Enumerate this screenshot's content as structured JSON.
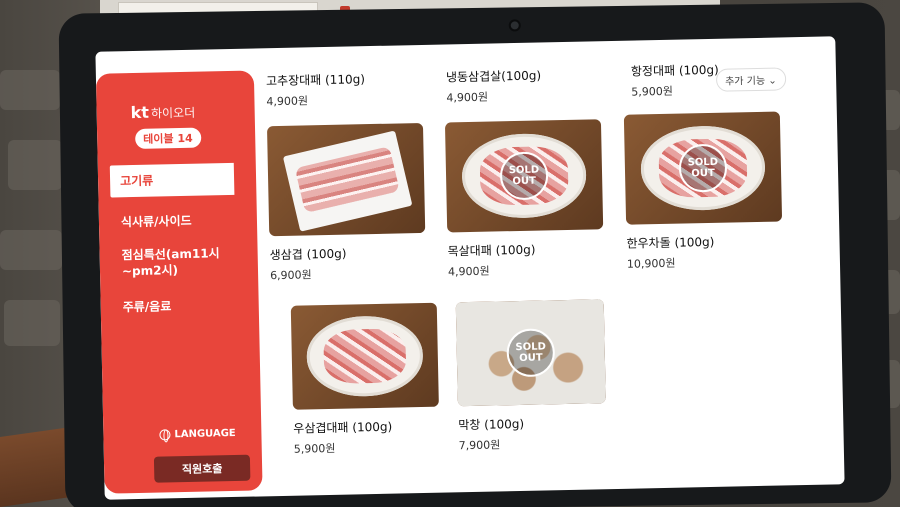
{
  "sidebar": {
    "brand_prefix": "kt",
    "brand_name": "하이오더",
    "table_label": "테이블 14",
    "categories": [
      {
        "label": "고기류"
      },
      {
        "label": "식사류/사이드"
      },
      {
        "label": "점심특선(am11시~pm2시)"
      },
      {
        "label": "주류/음료"
      }
    ],
    "language_label": "LANGUAGE",
    "call_staff_label": "직원호출"
  },
  "toolbar": {
    "more_label": "추가 기능"
  },
  "menu": {
    "top_row": [
      {
        "name": "고추장대패 (110g)",
        "price": "4,900원"
      },
      {
        "name": "냉동삼겹살(100g)",
        "price": "4,900원"
      },
      {
        "name": "항정대패 (100g)",
        "price": "5,900원"
      }
    ],
    "items": [
      {
        "name": "생삼겹 (100g)",
        "price": "6,900원",
        "sold_out": false
      },
      {
        "name": "목살대패 (100g)",
        "price": "4,900원",
        "sold_out": true,
        "sold_out_label": "SOLD OUT"
      },
      {
        "name": "한우차돌 (100g)",
        "price": "10,900원",
        "sold_out": true,
        "sold_out_label": "SOLD OUT"
      },
      {
        "name": "우삼겹대패 (100g)",
        "price": "5,900원",
        "sold_out": false
      },
      {
        "name": "막창 (100g)",
        "price": "7,900원",
        "sold_out": true,
        "sold_out_label": "SOLD OUT"
      }
    ]
  },
  "colors": {
    "accent": "#e8453b",
    "call_button": "#7a2a24"
  }
}
